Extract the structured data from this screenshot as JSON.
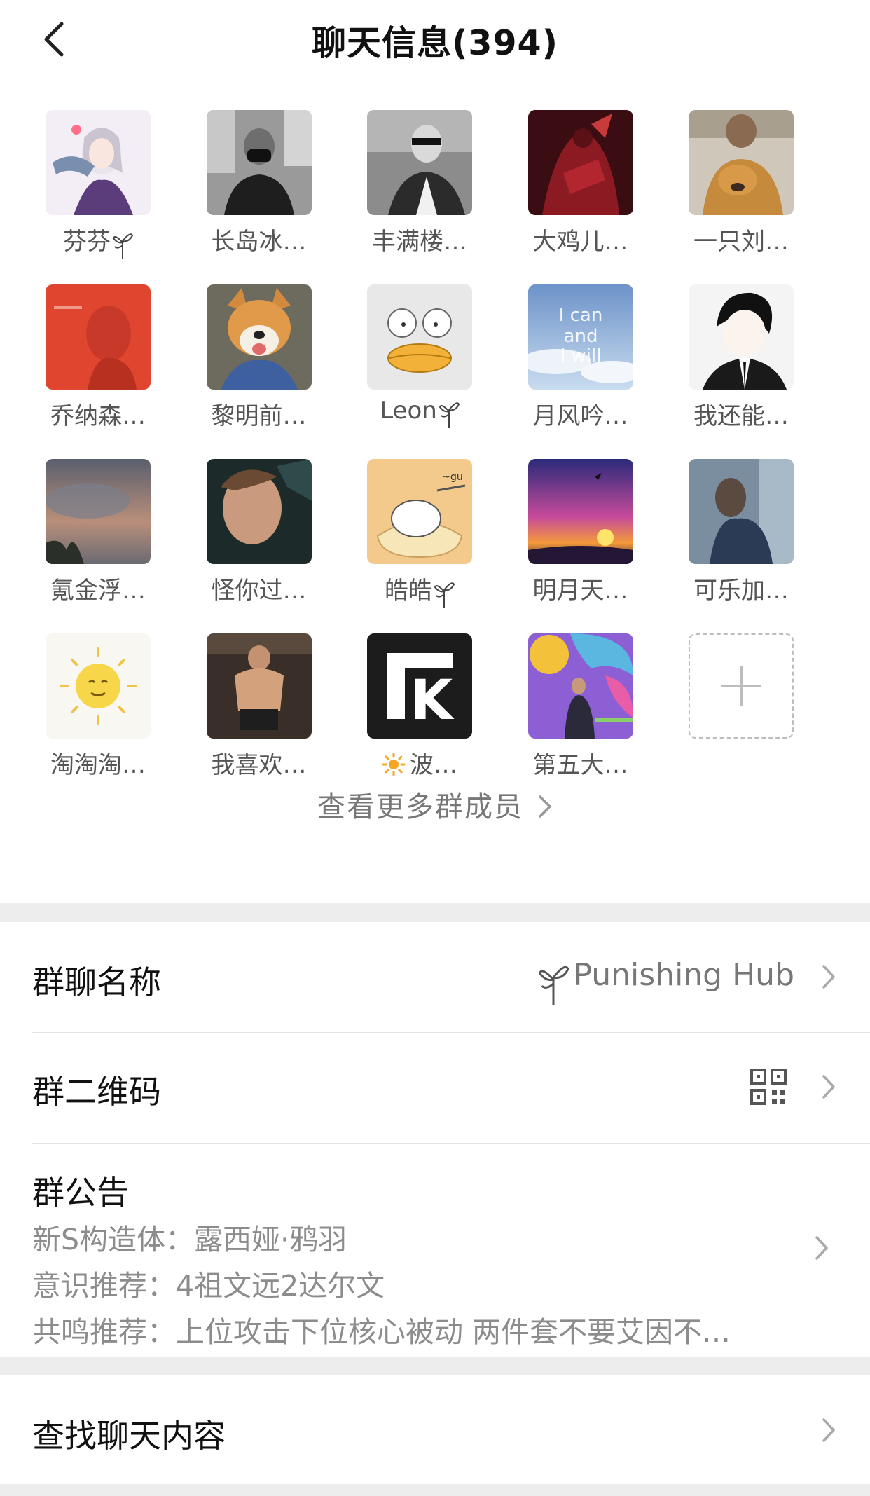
{
  "header": {
    "title": "聊天信息(394)",
    "back_icon": "chevron-left-icon"
  },
  "members": [
    {
      "name": "芬芬",
      "badge": "plant"
    },
    {
      "name": "长岛冰…",
      "badge": ""
    },
    {
      "name": "丰满楼…",
      "badge": ""
    },
    {
      "name": "大鸡儿…",
      "badge": ""
    },
    {
      "name": "一只刘…",
      "badge": ""
    },
    {
      "name": "乔纳森…",
      "badge": ""
    },
    {
      "name": "黎明前…",
      "badge": ""
    },
    {
      "name": "Leon",
      "badge": "plant"
    },
    {
      "name": "月风吟…",
      "badge": ""
    },
    {
      "name": "我还能…",
      "badge": ""
    },
    {
      "name": "氪金浮…",
      "badge": ""
    },
    {
      "name": "怪你过…",
      "badge": ""
    },
    {
      "name": "皓皓",
      "badge": "plant"
    },
    {
      "name": "明月天…",
      "badge": ""
    },
    {
      "name": "可乐加…",
      "badge": ""
    },
    {
      "name": "淘淘淘…",
      "badge": ""
    },
    {
      "name": "我喜欢…",
      "badge": ""
    },
    {
      "name": "波…",
      "badge": "sun"
    },
    {
      "name": "第五大…",
      "badge": ""
    }
  ],
  "avatar_texts": {
    "moon_wind": "I can and I will",
    "tk_logo": "K",
    "cat_bubble": "~gu"
  },
  "more_members_label": "查看更多群成员",
  "settings": {
    "group_name": {
      "label": "群聊名称",
      "value": "Punishing Hub"
    },
    "qr_code": {
      "label": "群二维码"
    },
    "notice": {
      "label": "群公告",
      "lines": [
        "新S构造体：露西娅·鸦羽",
        "意识推荐：4祖文远2达尔文",
        "共鸣推荐：上位攻击下位核心被动 两件套不要艾因不…"
      ]
    },
    "search_history": {
      "label": "查找聊天内容"
    }
  }
}
